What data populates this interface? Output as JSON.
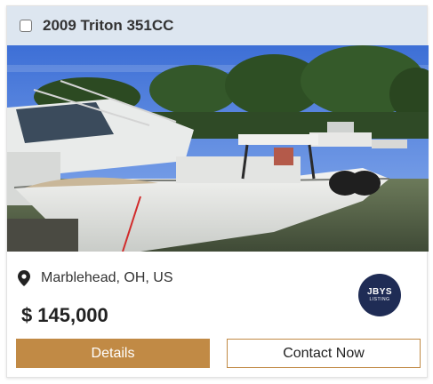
{
  "listing": {
    "title": "2009 Triton 351CC",
    "location": "Marblehead, OH, US",
    "currency_symbol": "$",
    "price": "145,000",
    "photo_alt": "2009 Triton 351CC",
    "broker_logo": {
      "main": "JBYS",
      "sub": "LISTING"
    }
  },
  "actions": {
    "details_label": "Details",
    "contact_label": "Contact Now"
  },
  "icons": {
    "location": "map-pin-icon"
  },
  "colors": {
    "header_bg": "#dde6f0",
    "accent": "#c18a45",
    "logo_bg": "#1f2c55"
  }
}
